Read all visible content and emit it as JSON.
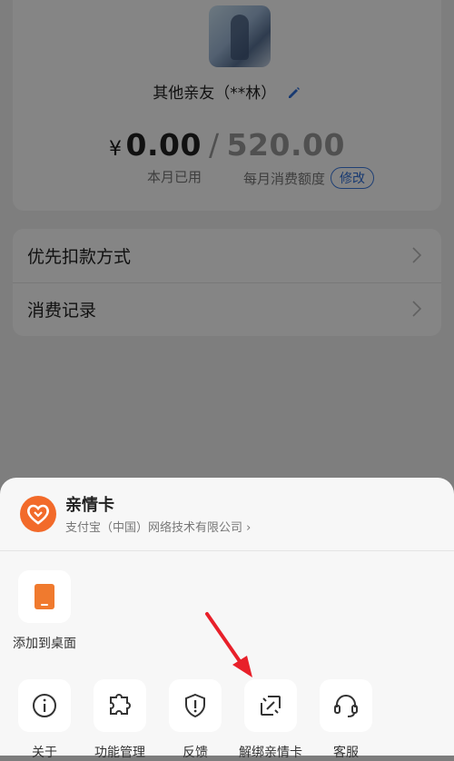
{
  "profile": {
    "name": "其他亲友（**林）",
    "currency_symbol": "¥",
    "used_amount": "0.00",
    "separator": "/",
    "quota_amount": "520.00",
    "used_caption": "本月已用",
    "quota_caption": "每月消费额度",
    "modify_label": "修改"
  },
  "menu": {
    "items": [
      {
        "label": "优先扣款方式"
      },
      {
        "label": "消费记录"
      }
    ]
  },
  "sheet": {
    "app_name": "亲情卡",
    "company": "支付宝（中国）网络技术有限公司",
    "add_to_desktop": "添加到桌面",
    "actions": [
      {
        "label": "关于",
        "icon": "info-icon"
      },
      {
        "label": "功能管理",
        "icon": "puzzle-icon"
      },
      {
        "label": "反馈",
        "icon": "shield-alert-icon"
      },
      {
        "label": "解绑亲情卡",
        "icon": "unlink-icon"
      },
      {
        "label": "客服",
        "icon": "headset-icon"
      }
    ]
  },
  "colors": {
    "accent": "#2f6fd9",
    "brand_orange": "#f26a2a",
    "annotation_red": "#e8202a"
  }
}
